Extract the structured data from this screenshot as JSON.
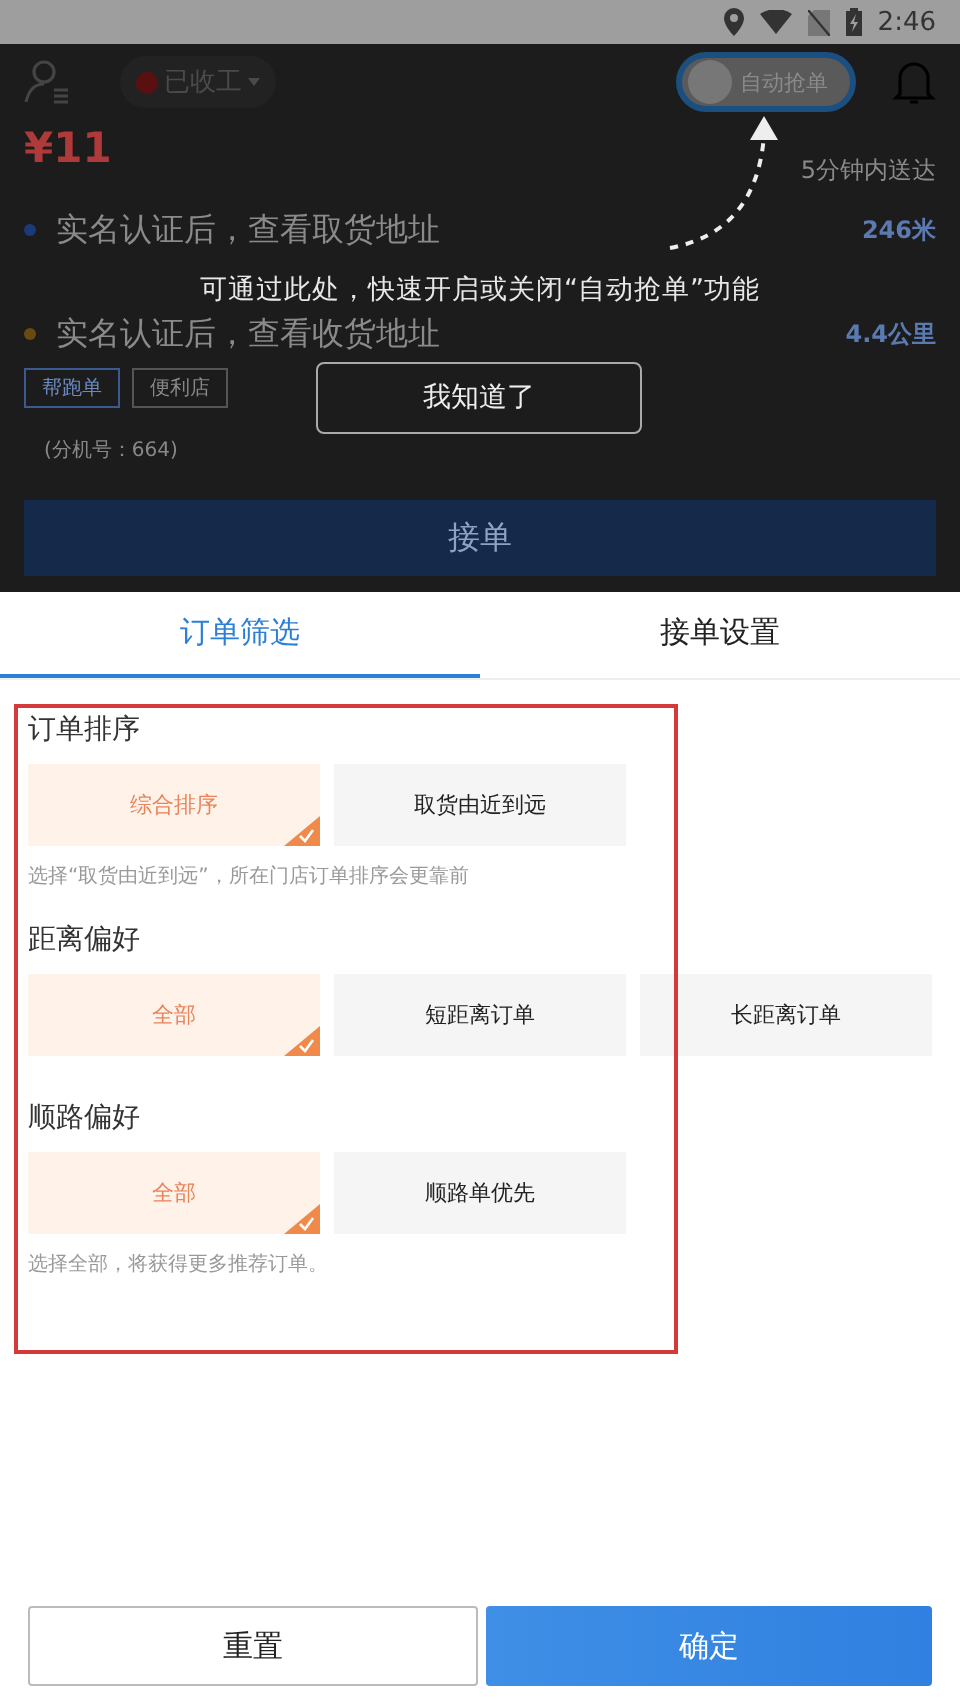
{
  "status_bar": {
    "time": "2:46"
  },
  "header": {
    "work_status": "已收工",
    "auto_grab": {
      "label": "自动抢单",
      "on": false
    }
  },
  "order": {
    "price": "¥11",
    "delivery_time": "5分钟内送达",
    "stops": [
      {
        "text": "实名认证后，查看取货地址",
        "distance": "246米",
        "color": "#1a3a7a"
      },
      {
        "text": "实名认证后，查看收货地址",
        "distance": "4.4公里",
        "color": "#6a4a10"
      }
    ],
    "tags": [
      "帮跑单",
      "便利店"
    ],
    "extension": "(分机号：664)",
    "accept_button": "接单"
  },
  "guide": {
    "tip": "可通过此处，快速开启或关闭“自动抢单”功能",
    "dismiss_button": "我知道了"
  },
  "tabs": [
    {
      "label": "订单筛选",
      "selected": true
    },
    {
      "label": "接单设置",
      "selected": false
    }
  ],
  "sections": [
    {
      "title": "订单排序",
      "options": [
        {
          "label": "综合排序",
          "selected": true
        },
        {
          "label": "取货由近到远",
          "selected": false
        }
      ],
      "note": "选择“取货由近到远”，所在门店订单排序会更靠前"
    },
    {
      "title": "距离偏好",
      "options": [
        {
          "label": "全部",
          "selected": true
        },
        {
          "label": "短距离订单",
          "selected": false
        },
        {
          "label": "长距离订单",
          "selected": false
        }
      ]
    },
    {
      "title": "顺路偏好",
      "options": [
        {
          "label": "全部",
          "selected": true
        },
        {
          "label": "顺路单优先",
          "selected": false
        }
      ],
      "note": "选择全部，将获得更多推荐订单。"
    }
  ],
  "buttons": {
    "reset": "重置",
    "confirm": "确定"
  }
}
